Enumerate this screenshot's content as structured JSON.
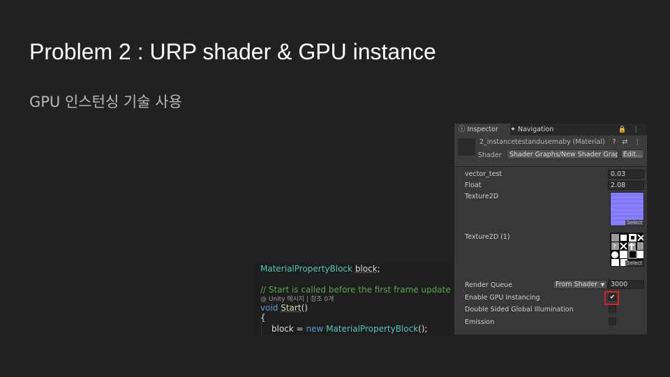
{
  "slide": {
    "title": "Problem 2 : URP shader & GPU instance",
    "subtitle": "GPU 인스턴싱 기술 사용"
  },
  "code": {
    "line1_type": "MaterialPropertyBlock",
    "line1_var": "block",
    "line1_end": ";",
    "comment": "// Start is called before the first frame update",
    "hint": "@ Unity 메시지 | 참조 0개",
    "void_kw": "void",
    "fn_name": "Start",
    "fn_parens": "()",
    "brace": "{",
    "assign_var": "block",
    "assign_eq": " = ",
    "new_kw": "new",
    "new_type": "MaterialPropertyBlock",
    "new_end": "();"
  },
  "inspector": {
    "tabs": [
      {
        "label": "Inspector",
        "icon": "info-icon"
      },
      {
        "label": "Navigation",
        "icon": "navigation-icon"
      }
    ],
    "tab_icons": "🔒 ⋮",
    "material_name": "2_instancetestandusemaby (Material)",
    "header_icons": "? ⇄ ⋮",
    "shader_label": "Shader",
    "shader_value": "Shader Graphs/New Shader Grap",
    "shader_edit": "Edit...",
    "props": {
      "vector_label": "vector_test",
      "vector_value": "0.03",
      "float_label": "Float",
      "float_value": "2.08",
      "tex1_label": "Texture2D",
      "tex1_select": "Select",
      "tex2_label": "Texture2D (1)",
      "tex2_select": "Select",
      "render_queue_label": "Render Queue",
      "render_queue_mode": "From Shader",
      "render_queue_value": "3000",
      "gpu_instancing_label": "Enable GPU Instancing",
      "gpu_instancing_checked": "✔",
      "double_sided_label": "Double Sided Global Illumination",
      "emission_label": "Emission"
    }
  },
  "colors": {
    "highlight": "#e02020",
    "texture_blue": "#8a80ff"
  }
}
